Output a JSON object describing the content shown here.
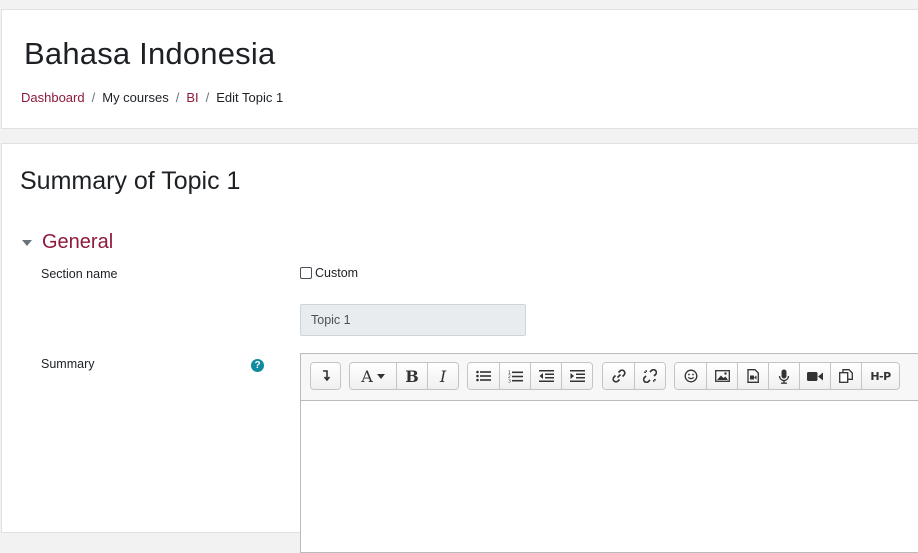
{
  "header": {
    "course_title": "Bahasa Indonesia",
    "breadcrumb": [
      {
        "label": "Dashboard",
        "link": true
      },
      {
        "label": "My courses",
        "link": false
      },
      {
        "label": "BI",
        "link": true
      },
      {
        "label": "Edit Topic 1",
        "link": false
      }
    ],
    "separator": "/"
  },
  "main": {
    "heading": "Summary of Topic 1",
    "section": {
      "title": "General",
      "icon": "caret-down-icon"
    },
    "fields": {
      "section_name_label": "Section name",
      "custom_label": "Custom",
      "custom_checked": false,
      "section_name_value": "Topic 1",
      "summary_label": "Summary",
      "help_icon": "?"
    },
    "toolbar": {
      "bold": "B",
      "italic": "I",
      "font": "A",
      "h5p": "H-P"
    }
  },
  "colors": {
    "link": "#8f1a3b",
    "help": "#0f8a9f",
    "input_bg": "#e9ecef"
  }
}
